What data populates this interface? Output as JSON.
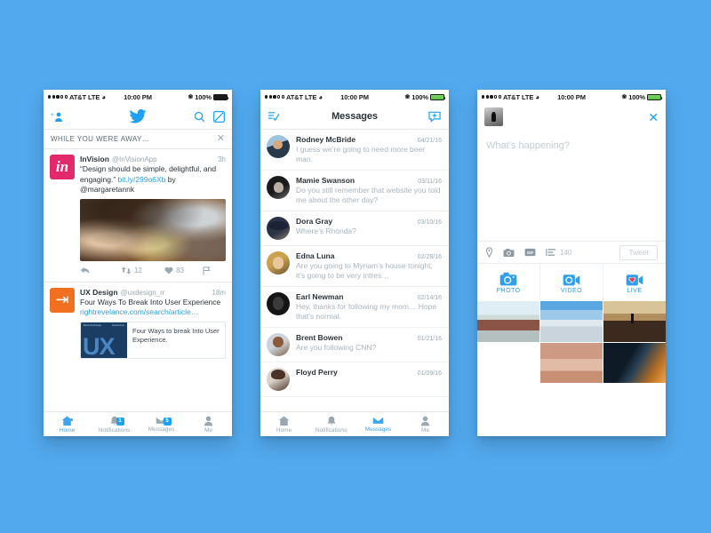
{
  "canvas": {
    "background_color": "#52a9ee"
  },
  "status_bar": {
    "carrier": "AT&T LTE",
    "time": "10:00 PM",
    "battery": "100%"
  },
  "phone1": {
    "nav": {
      "add_person_icon": "add-person-icon",
      "logo_icon": "twitter-bird-icon",
      "search_icon": "search-icon",
      "compose_icon": "compose-icon"
    },
    "while_you_were_away": {
      "label": "WHILE YOU WERE AWAY…",
      "close_icon": "close-icon"
    },
    "tweets": [
      {
        "avatar_glyph": "in",
        "name": "InVision",
        "handle": "@InVisionApp",
        "time": "3h",
        "text_part1": "“Design should be simple, delightful, and engaging.” ",
        "link": "bit.ly/299o6Xb",
        "text_part2": " by @margaretannk",
        "has_photo": true,
        "actions": {
          "reply": "",
          "retweet_count": "12",
          "like_count": "83",
          "share": ""
        }
      },
      {
        "avatar_glyph": "⇥",
        "name": "UX Design",
        "handle": "@uxdesign_rr",
        "time": "18m",
        "text_part1": "Four Ways To Break Into User Experience ",
        "link": "rightrevelance.com/search/article…",
        "text_part2": "",
        "has_photo": false,
        "link_card": {
          "thumb_label": "UX",
          "thumb_top_left": "Basic Exchange",
          "thumb_top_right": "Experience",
          "title": "Four Ways to break Into User Experience."
        }
      }
    ],
    "tabs": [
      {
        "label": "Home",
        "icon": "home-icon",
        "active": true,
        "badge": "",
        "dot": true
      },
      {
        "label": "Notifications",
        "icon": "bell-icon",
        "active": false,
        "badge": "1",
        "dot": false
      },
      {
        "label": "Messages",
        "icon": "message-icon",
        "active": false,
        "badge": "5",
        "dot": false
      },
      {
        "label": "Me",
        "icon": "person-icon",
        "active": false,
        "badge": "",
        "dot": false
      }
    ]
  },
  "phone2": {
    "nav": {
      "left_icon": "mark-all-read-icon",
      "title": "Messages",
      "right_icon": "new-message-icon"
    },
    "messages": [
      {
        "name": "Rodney McBride",
        "date": "04/21/16",
        "preview": "I guess we’re going to need more beer man.",
        "avatar": "av-rodney"
      },
      {
        "name": "Mamie Swanson",
        "date": "03/11/16",
        "preview": "Do you still remember that website you told me about the other day?",
        "avatar": "av-mamie"
      },
      {
        "name": "Dora Gray",
        "date": "03/10/16",
        "preview": "Where’s Rhonda?",
        "avatar": "av-dora"
      },
      {
        "name": "Edna Luna",
        "date": "02/28/16",
        "preview": "Are you going to Myriam’s house tonight, it’s going to be very intres…",
        "avatar": "av-edna"
      },
      {
        "name": "Earl Newman",
        "date": "02/14/16",
        "preview": "Hey, thanks for following my mom… Hope that’s normal.",
        "avatar": "av-earl"
      },
      {
        "name": "Brent Bowen",
        "date": "01/21/16",
        "preview": "Are you following CNN?",
        "avatar": "av-brent"
      },
      {
        "name": "Floyd Perry",
        "date": "01/09/16",
        "preview": "",
        "avatar": "av-floyd"
      }
    ],
    "tabs": [
      {
        "label": "Home",
        "icon": "home-icon",
        "active": false
      },
      {
        "label": "Notifications",
        "icon": "bell-icon",
        "active": false
      },
      {
        "label": "Messages",
        "icon": "message-icon",
        "active": true
      },
      {
        "label": "Me",
        "icon": "person-icon",
        "active": false
      }
    ]
  },
  "phone3": {
    "nav": {
      "avatar": "user-avatar",
      "close_icon": "close-icon"
    },
    "composer": {
      "placeholder": "What’s happening?",
      "value": ""
    },
    "toolbar": {
      "location_icon": "location-pin-icon",
      "camera_icon": "camera-icon",
      "gif_icon": "gif-icon",
      "poll_icon": "poll-icon",
      "char_count": "140",
      "tweet_label": "Tweet"
    },
    "media_tabs": [
      {
        "label": "PHOTO",
        "icon": "camera-icon"
      },
      {
        "label": "VIDEO",
        "icon": "video-icon"
      },
      {
        "label": "LIVE",
        "icon": "live-icon"
      }
    ],
    "photo_grid": [
      "pc1",
      "pc2",
      "pc3",
      "pc4",
      "pc5",
      "pc6"
    ]
  }
}
